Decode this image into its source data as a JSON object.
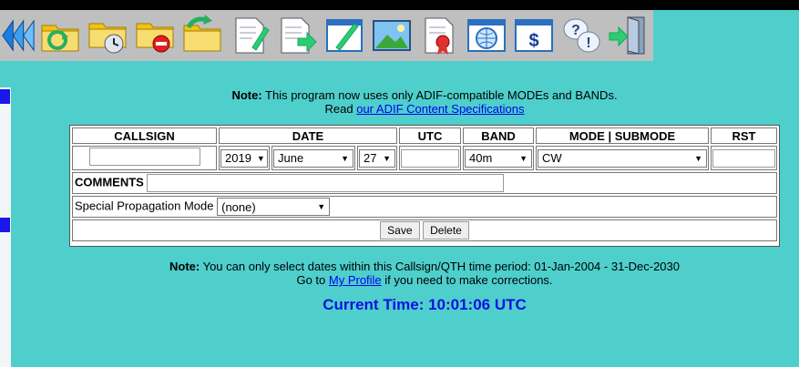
{
  "toolbar": {
    "icons": [
      "back-arrow-icon",
      "folder-refresh-icon",
      "folder-clock-icon",
      "folder-delete-icon",
      "folder-recycle-icon",
      "document-edit-icon",
      "document-export-icon",
      "pencil-note-icon",
      "landscape-image-icon",
      "certificate-icon",
      "globe-icon",
      "dollar-icon",
      "help-icon",
      "exit-door-icon"
    ]
  },
  "notice": {
    "bold": "Note:",
    "text": " This program now uses only ADIF-compatible MODEs and BANDs.",
    "read": "Read ",
    "link": "our ADIF Content Specifications"
  },
  "form": {
    "headers": {
      "callsign": "CALLSIGN",
      "date": "DATE",
      "utc": "UTC",
      "band": "BAND",
      "mode": "MODE | SUBMODE",
      "rst": "RST"
    },
    "callsign_value": "",
    "year": "2019",
    "month": "June",
    "day": "27",
    "utc_value": "",
    "band": "40m",
    "mode": "CW",
    "rst_value": "",
    "comments_label": "COMMENTS",
    "comments_value": "",
    "propagation_label": "Special Propagation Mode",
    "propagation_value": "(none)",
    "save_label": "Save",
    "delete_label": "Delete"
  },
  "footer_note": {
    "bold": "Note:",
    "text": " You can only select dates within this Callsign/QTH time period: 01-Jan-2004 - 31-Dec-2030",
    "goto": "Go to ",
    "link": "My Profile",
    "rest": " if you need to make corrections."
  },
  "current_time": "Current Time: 10:01:06 UTC",
  "colors": {
    "background": "#4ecfcc",
    "toolbar": "#bfbfbf",
    "time_text": "#1010e0",
    "link": "#0000ee"
  }
}
